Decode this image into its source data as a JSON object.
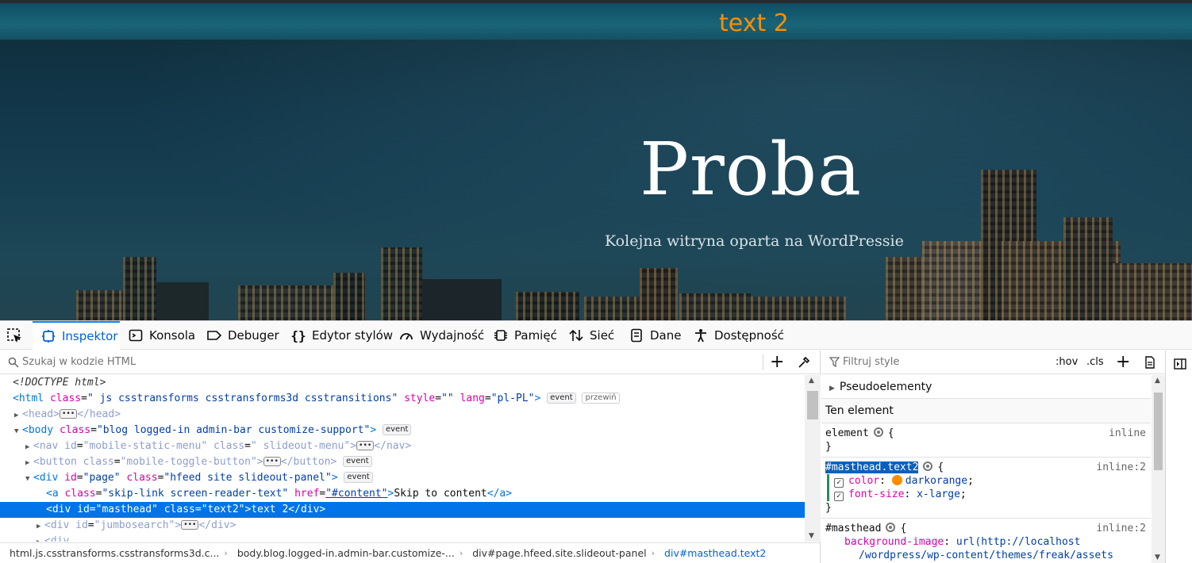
{
  "page": {
    "masthead_text": "text 2",
    "site_title": "Proba",
    "site_description": "Kolejna witryna oparta na WordPressie"
  },
  "devtools": {
    "tabs": [
      {
        "label": "Inspektor",
        "icon": "inspector-icon",
        "active": true
      },
      {
        "label": "Konsola",
        "icon": "console-icon"
      },
      {
        "label": "Debuger",
        "icon": "debugger-icon"
      },
      {
        "label": "Edytor stylów",
        "icon": "style-editor-icon"
      },
      {
        "label": "Wydajność",
        "icon": "performance-icon"
      },
      {
        "label": "Pamięć",
        "icon": "memory-icon"
      },
      {
        "label": "Sieć",
        "icon": "network-icon"
      },
      {
        "label": "Dane",
        "icon": "storage-icon"
      },
      {
        "label": "Dostępność",
        "icon": "accessibility-icon"
      }
    ],
    "markup": {
      "search_placeholder": "Szukaj w kodzie HTML",
      "lines": {
        "doctype": "<!DOCTYPE html>",
        "html_class": "\" js csstransforms csstransforms3d csstransitions\"",
        "html_style": "\"\"",
        "html_lang": "\"pl-PL\"",
        "body_class": "\"blog logged-in admin-bar customize-support\"",
        "nav_id": "\"mobile-static-menu\"",
        "nav_class": "\" slideout-menu\"",
        "button_class": "\"mobile-toggle-button\"",
        "page_id": "\"page\"",
        "page_class": "\"hfeed site slideout-panel\"",
        "a_class": "\"skip-link screen-reader-text\"",
        "a_href": "\"#content\"",
        "a_text": "Skip to content",
        "masthead_id": "\"masthead\"",
        "masthead_class": "\"text2\"",
        "masthead_text": "text 2",
        "jumbo_id": "\"jumbosearch\"",
        "badge_event": "event",
        "badge_scroll": "przewiń"
      },
      "breadcrumbs": [
        "html.js.csstransforms.csstransforms3d.c...",
        "body.blog.logged-in.admin-bar.customize-...",
        "div#page.hfeed.site.slideout-panel",
        "div#masthead.text2"
      ]
    },
    "rules": {
      "filter_placeholder": "Filtruj style",
      "hov_label": ":hov",
      "cls_label": ".cls",
      "pseudo_label": "Pseudoelementy",
      "this_element_label": "Ten element",
      "rule1": {
        "selector": "element",
        "source": "inline"
      },
      "rule2": {
        "selector": "#masthead.text2",
        "source": "inline:2",
        "decls": [
          {
            "prop": "color",
            "value": "darkorange"
          },
          {
            "prop": "font-size",
            "value": "x-large"
          }
        ]
      },
      "rule3": {
        "selector": "#masthead",
        "source": "inline:2",
        "prop": "background-image",
        "value_line1": "url(http://localhost",
        "value_line2": "/wordpress/wp-content/themes/freak/assets"
      }
    },
    "colors": {
      "accent": "#0a84ff",
      "selection": "#0074e8",
      "darkorange": "#ff8c00"
    }
  }
}
